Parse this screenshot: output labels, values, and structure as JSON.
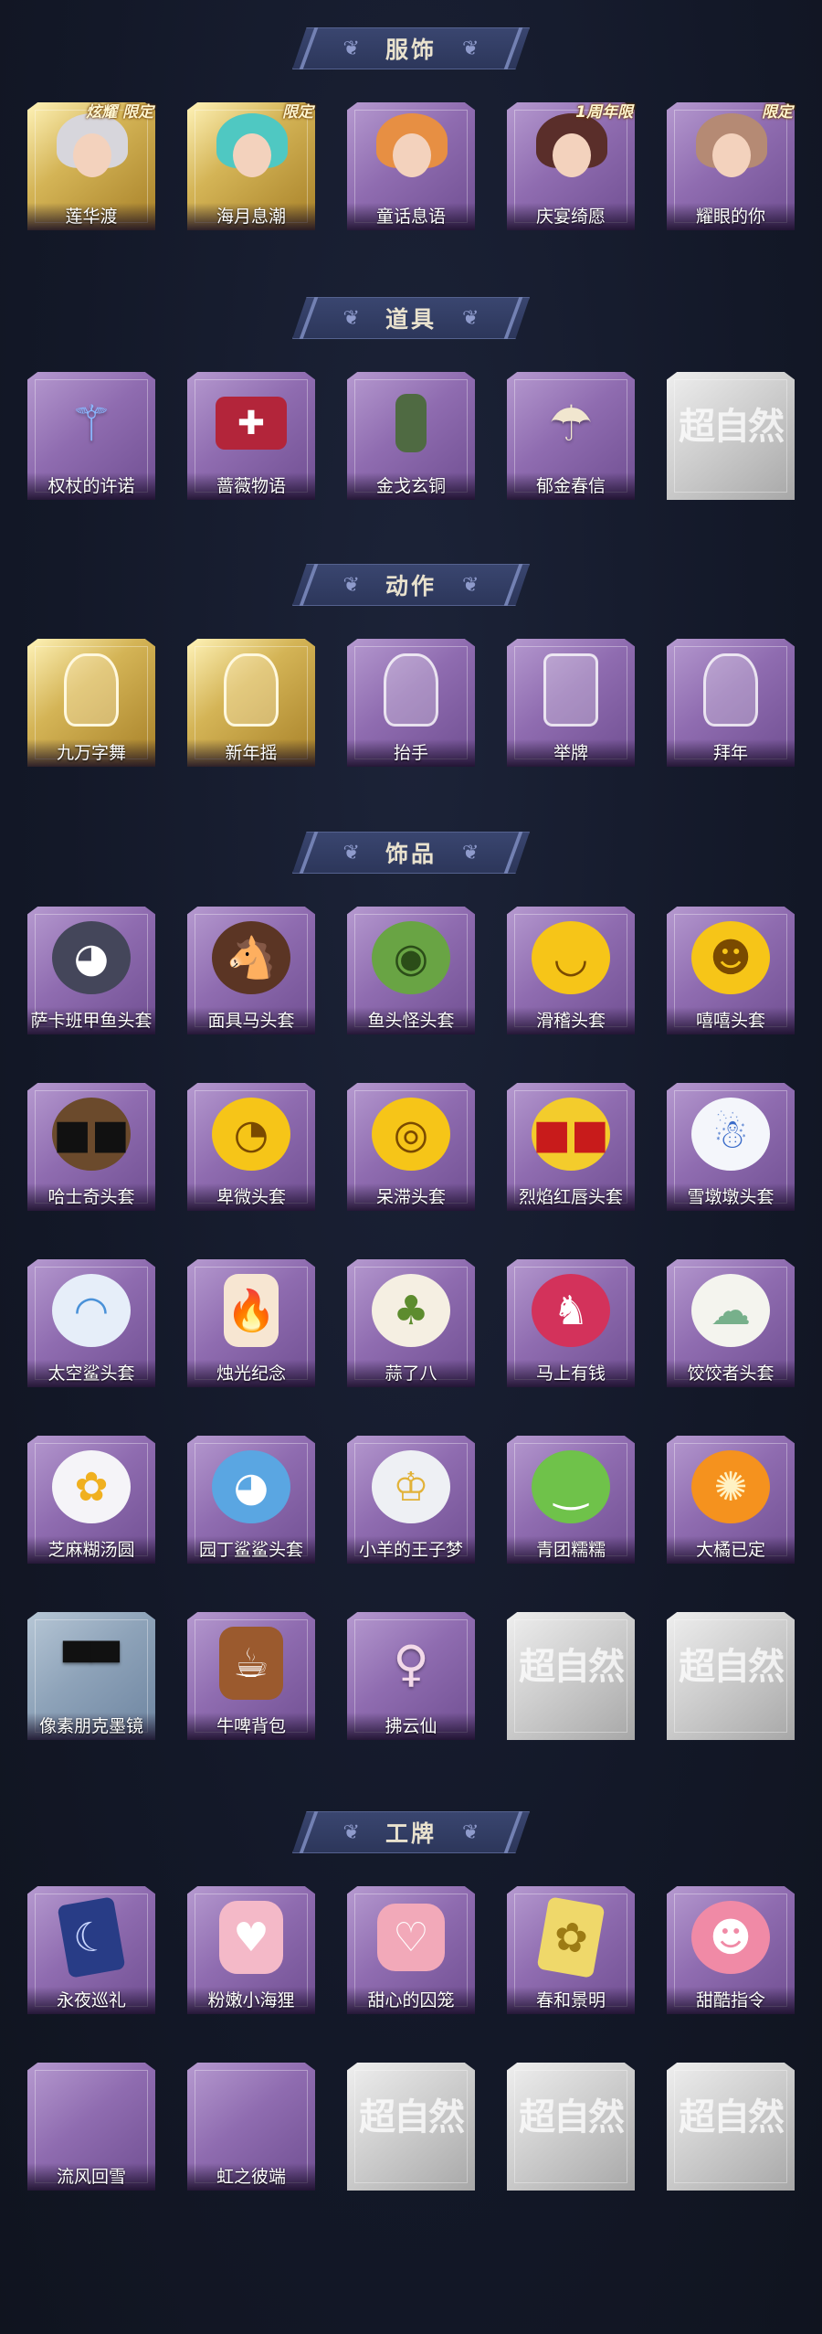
{
  "sections": {
    "costumes": {
      "title": "服饰",
      "items": [
        {
          "label": "莲华渡",
          "badge": "炫耀 限定",
          "frame": "gold"
        },
        {
          "label": "海月息潮",
          "badge": "限定",
          "frame": "gold"
        },
        {
          "label": "童话息语",
          "badge": "",
          "frame": "purple"
        },
        {
          "label": "庆宴绮愿",
          "badge": "1周年限",
          "frame": "purple"
        },
        {
          "label": "耀眼的你",
          "badge": "限定",
          "frame": "purple"
        }
      ]
    },
    "props": {
      "title": "道具",
      "items": [
        {
          "label": "权杖的许诺",
          "frame": "purple"
        },
        {
          "label": "蔷薇物语",
          "frame": "purple"
        },
        {
          "label": "金戈玄铜",
          "frame": "purple"
        },
        {
          "label": "郁金春信",
          "frame": "purple"
        },
        {
          "label": "",
          "frame": "grey",
          "watermark": "超自然"
        }
      ]
    },
    "actions": {
      "title": "动作",
      "items": [
        {
          "label": "九万字舞",
          "frame": "gold"
        },
        {
          "label": "新年摇",
          "frame": "gold"
        },
        {
          "label": "抬手",
          "frame": "purple"
        },
        {
          "label": "举牌",
          "frame": "purple"
        },
        {
          "label": "拜年",
          "frame": "purple"
        }
      ]
    },
    "accessories": {
      "title": "饰品",
      "rows": [
        [
          {
            "label": "萨卡班甲鱼头套",
            "frame": "purple"
          },
          {
            "label": "面具马头套",
            "frame": "purple"
          },
          {
            "label": "鱼头怪头套",
            "frame": "purple"
          },
          {
            "label": "滑稽头套",
            "frame": "purple"
          },
          {
            "label": "嘻嘻头套",
            "frame": "purple"
          }
        ],
        [
          {
            "label": "哈士奇头套",
            "frame": "purple"
          },
          {
            "label": "卑微头套",
            "frame": "purple"
          },
          {
            "label": "呆滞头套",
            "frame": "purple"
          },
          {
            "label": "烈焰红唇头套",
            "frame": "purple"
          },
          {
            "label": "雪墩墩头套",
            "frame": "purple"
          }
        ],
        [
          {
            "label": "太空鲨头套",
            "frame": "purple"
          },
          {
            "label": "烛光纪念",
            "frame": "purple"
          },
          {
            "label": "蒜了八",
            "frame": "purple"
          },
          {
            "label": "马上有钱",
            "frame": "purple"
          },
          {
            "label": "饺饺者头套",
            "frame": "purple"
          }
        ],
        [
          {
            "label": "芝麻糊汤圆",
            "frame": "purple"
          },
          {
            "label": "园丁鲨鲨头套",
            "frame": "purple"
          },
          {
            "label": "小羊的王子梦",
            "frame": "purple"
          },
          {
            "label": "青团糯糯",
            "frame": "purple"
          },
          {
            "label": "大橘已定",
            "frame": "purple"
          }
        ],
        [
          {
            "label": "像素朋克墨镜",
            "frame": "bluegrey"
          },
          {
            "label": "牛啤背包",
            "frame": "purple"
          },
          {
            "label": "拂云仙",
            "frame": "purple"
          },
          {
            "label": "",
            "frame": "grey",
            "watermark": "超自然"
          },
          {
            "label": "",
            "frame": "grey",
            "watermark": "超自然"
          }
        ]
      ]
    },
    "badges": {
      "title": "工牌",
      "rows": [
        [
          {
            "label": "永夜巡礼",
            "frame": "purple"
          },
          {
            "label": "粉嫩小海狸",
            "frame": "purple"
          },
          {
            "label": "甜心的囚笼",
            "frame": "purple"
          },
          {
            "label": "春和景明",
            "frame": "purple"
          },
          {
            "label": "甜酷指令",
            "frame": "purple"
          }
        ],
        [
          {
            "label": "流风回雪",
            "frame": "purple"
          },
          {
            "label": "虹之彼端",
            "frame": "purple"
          },
          {
            "label": "",
            "frame": "grey",
            "watermark": "超自然"
          },
          {
            "label": "",
            "frame": "grey",
            "watermark": "超自然"
          },
          {
            "label": "",
            "frame": "grey",
            "watermark": "超自然"
          }
        ]
      ]
    }
  }
}
